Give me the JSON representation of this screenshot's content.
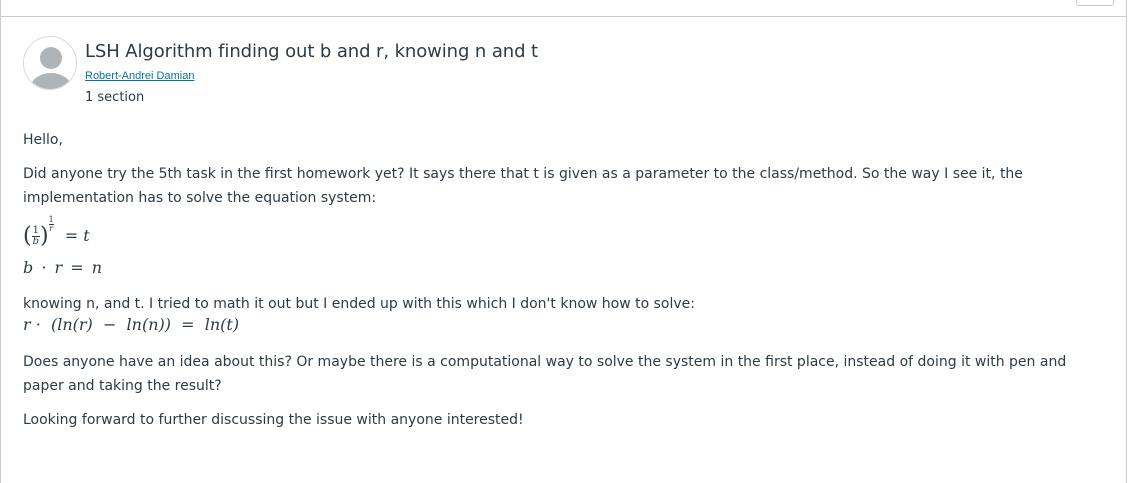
{
  "post": {
    "title": "LSH Algorithm finding out b and r, knowing n and t",
    "author": "Robert-Andrei Damian",
    "sections": "1 section"
  },
  "body": {
    "greeting": "Hello,",
    "paragraph1": "Did anyone try the 5th task in the first homework yet? It says there that t is given as a parameter to the class/method. So the way I see it, the implementation has to solve the equation system:",
    "eq1": {
      "frac_num": "1",
      "frac_den": "b",
      "exp_num": "1",
      "exp_den": "r",
      "rhs": "= t"
    },
    "eq2": "b · r = n",
    "paragraph2": "knowing n, and t. I tried to math it out but I ended up with this which I don't know how to solve:",
    "eq3": "r ·  (ln(r)  −  ln(n))  =  ln(t)",
    "paragraph3": "Does anyone have an idea about this? Or maybe there is a computational way to solve the system in the first place, instead of doing it with pen and paper and taking the result?",
    "paragraph4": "Looking forward to further discussing the issue with anyone interested!"
  },
  "colors": {
    "text": "#2d3b45",
    "link": "#0770a3",
    "border": "#c7cdd1",
    "avatar": "#aeb4b8"
  },
  "icons": {
    "avatar": "default-user-avatar-icon"
  }
}
